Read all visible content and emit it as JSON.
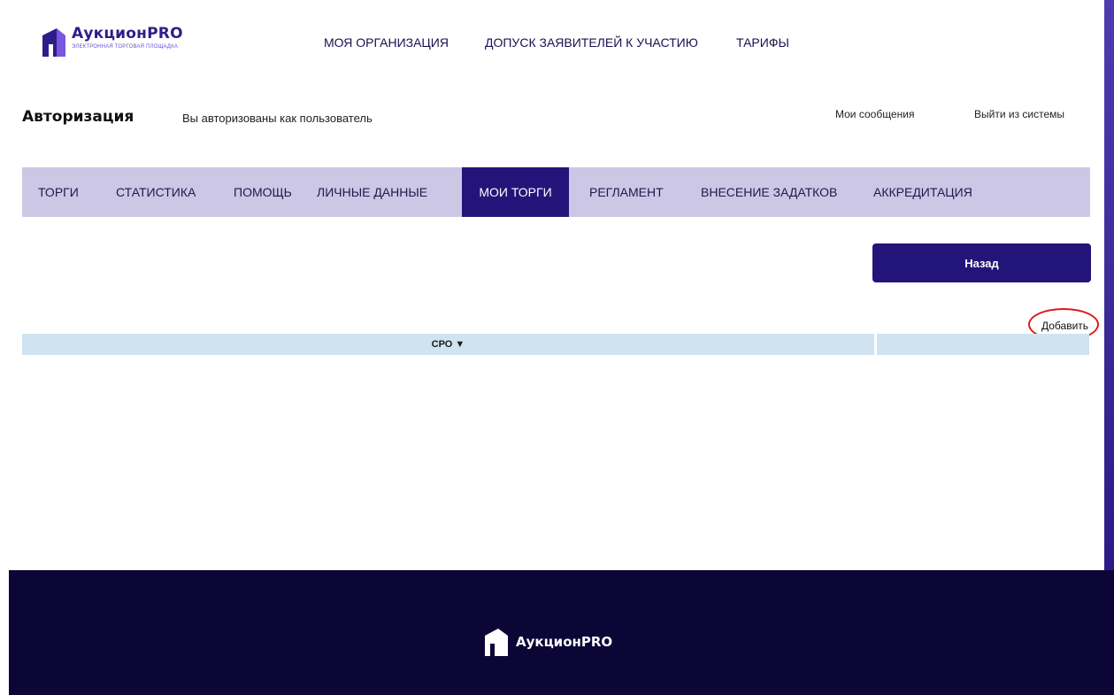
{
  "brand": {
    "name": "АукционPRO",
    "tagline": "ЭЛЕКТРОННАЯ ТОРГОВАЯ ПЛОЩАДКА"
  },
  "topnav": [
    "МОЯ ОРГАНИЗАЦИЯ",
    "ДОПУСК ЗАЯВИТЕЛЕЙ К УЧАСТИЮ",
    "ТАРИФЫ"
  ],
  "auth": {
    "title": "Авторизация",
    "subtitle": "Вы авторизованы как пользователь",
    "messages": "Мои сообщения",
    "logout": "Выйти из системы"
  },
  "mainnav": {
    "tabs": [
      "ТОРГИ",
      "СТАТИСТИКА",
      "ПОМОЩЬ",
      "ЛИЧНЫЕ ДАННЫЕ",
      "МОИ ТОРГИ",
      "РЕГЛАМЕНТ",
      "ВНЕСЕНИЕ ЗАДАТКОВ",
      "АККРЕДИТАЦИЯ"
    ],
    "active": "МОИ ТОРГИ"
  },
  "actions": {
    "back": "Назад",
    "add": "Добавить"
  },
  "table": {
    "columns": [
      "СРО ▼",
      ""
    ]
  },
  "footer": {
    "brand": "АукционPRO"
  },
  "colors": {
    "brand_dark": "#24147a",
    "nav_bg": "#cdc7e6",
    "footer_bg": "#0c0636",
    "table_header": "#cfe3f0",
    "annotation": "#e01818"
  }
}
